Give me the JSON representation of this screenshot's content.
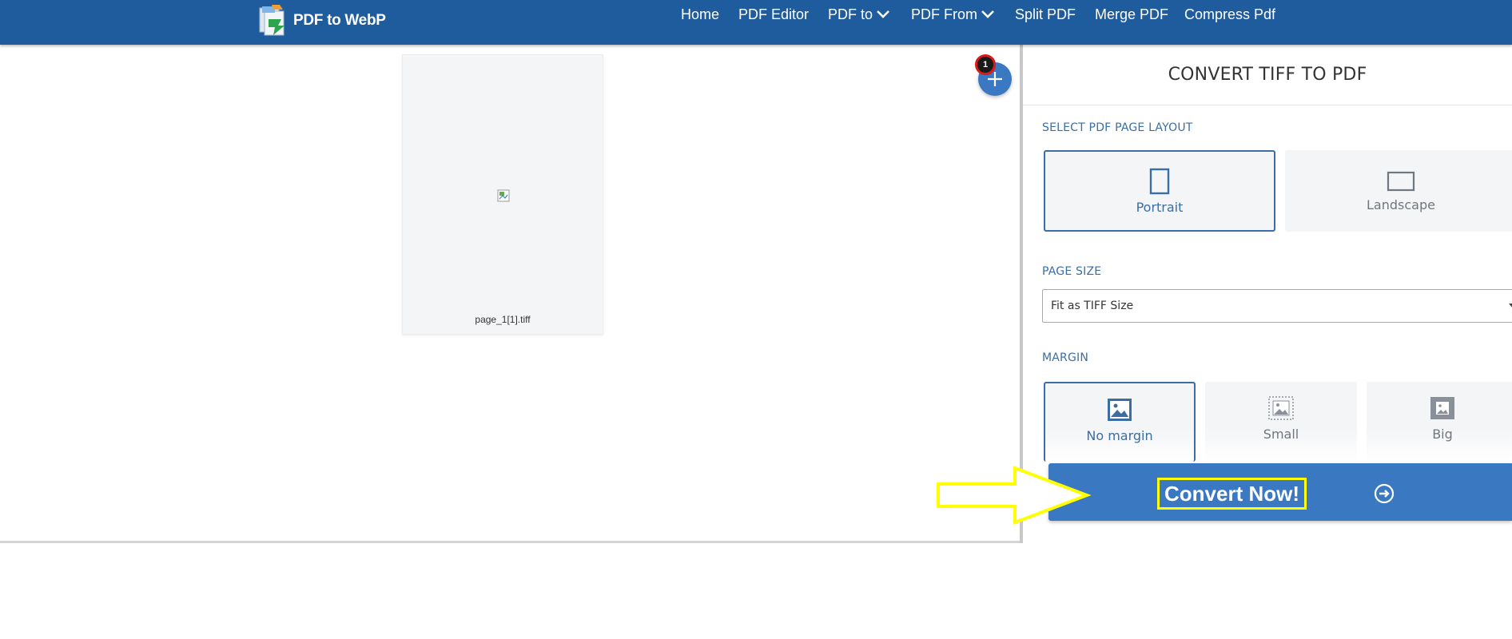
{
  "brand": {
    "name": "PDF to WebP"
  },
  "nav": {
    "home": "Home",
    "pdf_editor": "PDF Editor",
    "pdf_to": "PDF to",
    "pdf_from": "PDF From",
    "split_pdf": "Split PDF",
    "merge_pdf": "Merge PDF",
    "compress_pdf": "Compress Pdf"
  },
  "workspace": {
    "file_name": "page_1[1].tiff",
    "file_count": "1"
  },
  "sidebar": {
    "title": "CONVERT TIFF TO PDF",
    "layout_label": "SELECT PDF PAGE LAYOUT",
    "layout_options": [
      "Portrait",
      "Landscape"
    ],
    "layout_selected": "Portrait",
    "page_size_label": "PAGE SIZE",
    "page_size_value": "Fit as TIFF Size",
    "margin_label": "MARGIN",
    "margin_options": [
      "No margin",
      "Small",
      "Big"
    ],
    "margin_selected": "No margin"
  },
  "convert": {
    "label": "Convert Now!"
  },
  "colors": {
    "navbar": "#1f5c9e",
    "accent": "#3a78c2",
    "label_blue": "#3a6ea5",
    "highlight": "#ffff00",
    "badge_ring": "#d91a1a"
  },
  "icons": [
    "logo-icon",
    "chevron-down-icon",
    "broken-image-icon",
    "plus-icon",
    "portrait-page-icon",
    "landscape-page-icon",
    "image-no-margin-icon",
    "image-small-margin-icon",
    "image-big-margin-icon",
    "arrow-circle-right-icon",
    "annotation-arrow-icon"
  ]
}
